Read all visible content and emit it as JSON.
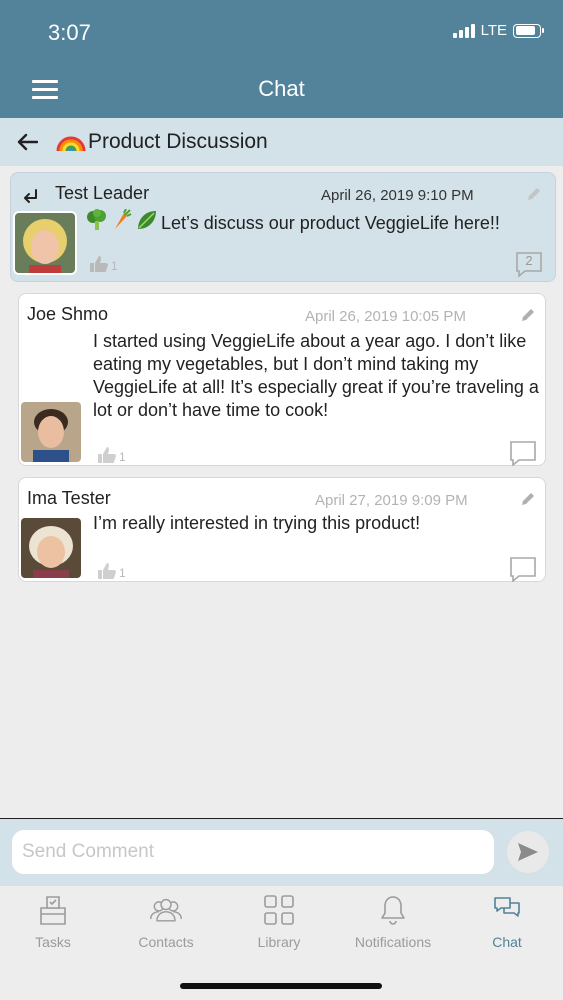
{
  "status_bar": {
    "time": "3:07",
    "network": "LTE",
    "battery_level": 0.85
  },
  "header": {
    "title": "Chat"
  },
  "subheader": {
    "room_title": "Product Discussion",
    "room_icon": "rainbow-emoji"
  },
  "posts": [
    {
      "author": "Test Leader",
      "timestamp": "April 26, 2019 9:10 PM",
      "body": "Let’s discuss our product VeggieLife here!!",
      "emojis": [
        "broccoli",
        "carrot",
        "leafy-greens"
      ],
      "likes": "1",
      "comments": "2",
      "is_leader": true
    },
    {
      "author": "Joe Shmo",
      "timestamp": "April 26, 2019 10:05 PM",
      "body": "I started using VeggieLife about a year ago. I don’t like eating my vegetables, but I don’t mind taking my VeggieLife at all! It’s especially great if you’re traveling a lot or don’t have time to cook!",
      "likes": "1"
    },
    {
      "author": "Ima Tester",
      "timestamp": "April 27, 2019 9:09 PM",
      "body": "I’m really interested in trying this product!",
      "likes": "1"
    }
  ],
  "composer": {
    "placeholder": "Send Comment",
    "value": ""
  },
  "tabs": [
    {
      "label": "Tasks",
      "icon": "tasks-icon"
    },
    {
      "label": "Contacts",
      "icon": "contacts-icon"
    },
    {
      "label": "Library",
      "icon": "library-icon"
    },
    {
      "label": "Notifications",
      "icon": "bell-icon"
    },
    {
      "label": "Chat",
      "icon": "chat-icon",
      "active": true
    }
  ],
  "colors": {
    "header": "#52839a",
    "subheader": "#d3e1e9",
    "active_tab": "#52839a"
  }
}
